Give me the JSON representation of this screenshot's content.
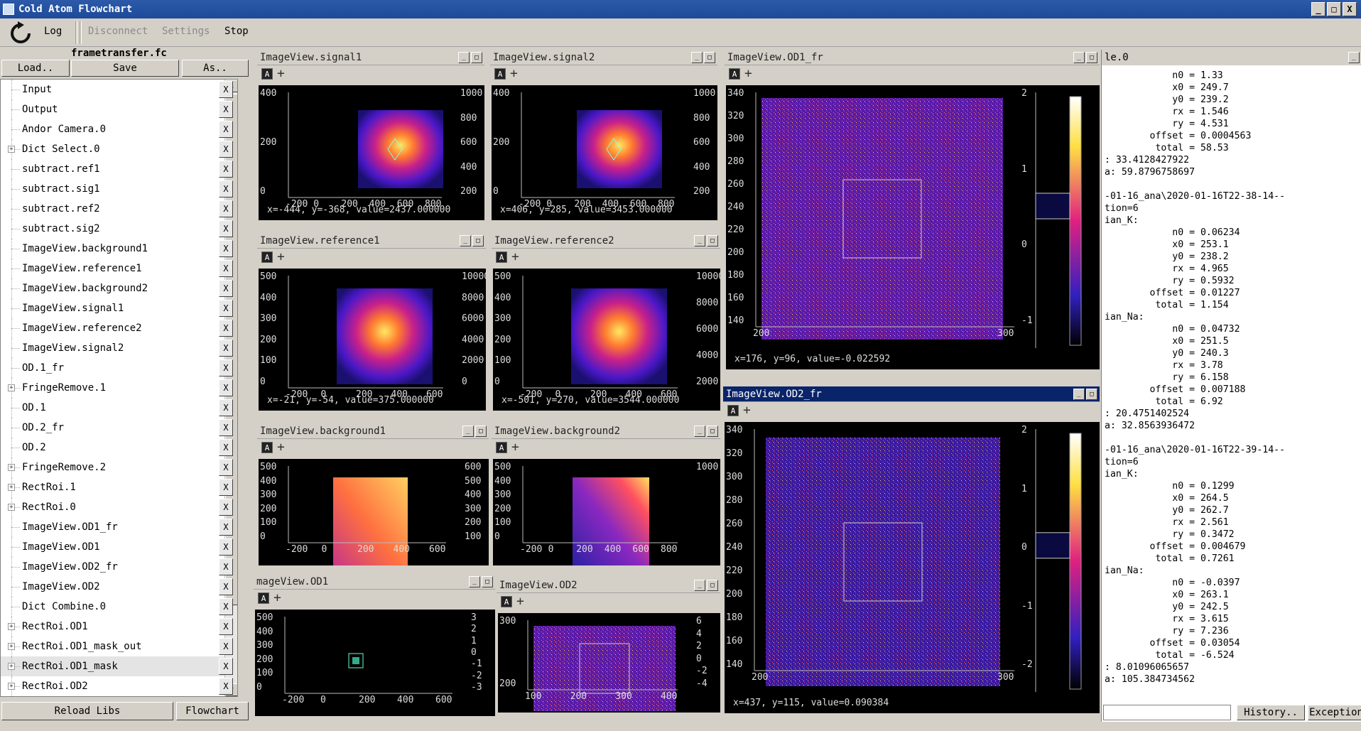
{
  "window": {
    "title": "Cold Atom Flowchart",
    "buttons": [
      "_",
      "□",
      "X"
    ]
  },
  "toolbar": {
    "log": "Log",
    "disconnect": "Disconnect",
    "settings": "Settings",
    "stop": "Stop"
  },
  "flowchart": {
    "filename": "frametransfer.fc",
    "load": "Load..",
    "save": "Save",
    "save_as": "As..",
    "reload_libs": "Reload Libs",
    "flowchart_btn": "Flowchart",
    "x_label": "X",
    "nodes": [
      {
        "label": "Input",
        "exp": false
      },
      {
        "label": "Output",
        "exp": false
      },
      {
        "label": "Andor Camera.0",
        "exp": false
      },
      {
        "label": "Dict Select.0",
        "exp": true
      },
      {
        "label": "subtract.ref1",
        "exp": false
      },
      {
        "label": "subtract.sig1",
        "exp": false
      },
      {
        "label": "subtract.ref2",
        "exp": false
      },
      {
        "label": "subtract.sig2",
        "exp": false
      },
      {
        "label": "ImageView.background1",
        "exp": false
      },
      {
        "label": "ImageView.reference1",
        "exp": false
      },
      {
        "label": "ImageView.background2",
        "exp": false
      },
      {
        "label": "ImageView.signal1",
        "exp": false
      },
      {
        "label": "ImageView.reference2",
        "exp": false
      },
      {
        "label": "ImageView.signal2",
        "exp": false
      },
      {
        "label": "OD.1_fr",
        "exp": false
      },
      {
        "label": "FringeRemove.1",
        "exp": true
      },
      {
        "label": "OD.1",
        "exp": false
      },
      {
        "label": "OD.2_fr",
        "exp": false
      },
      {
        "label": "OD.2",
        "exp": false
      },
      {
        "label": "FringeRemove.2",
        "exp": true
      },
      {
        "label": "RectRoi.1",
        "exp": true
      },
      {
        "label": "RectRoi.0",
        "exp": true
      },
      {
        "label": "ImageView.OD1_fr",
        "exp": false
      },
      {
        "label": "ImageView.OD1",
        "exp": false
      },
      {
        "label": "ImageView.OD2_fr",
        "exp": false
      },
      {
        "label": "ImageView.OD2",
        "exp": false
      },
      {
        "label": "Dict Combine.0",
        "exp": false
      },
      {
        "label": "RectRoi.OD1",
        "exp": true
      },
      {
        "label": "RectRoi.OD1_mask_out",
        "exp": true
      },
      {
        "label": "RectRoi.OD1_mask",
        "exp": true
      },
      {
        "label": "RectRoi.OD2",
        "exp": true
      }
    ]
  },
  "docks": {
    "signal1": {
      "title": "ImageView.signal1",
      "status": "x=-444, y=-368, value=2437.000000",
      "yticks": [
        "400",
        "200",
        "0"
      ],
      "xticks": [
        "-200",
        "0",
        "200",
        "400",
        "600",
        "800"
      ],
      "cbar": [
        "1000",
        "800",
        "600",
        "400",
        "200"
      ]
    },
    "signal2": {
      "title": "ImageView.signal2",
      "status": "x=406, y=285, value=3453.000000",
      "yticks": [
        "400",
        "200",
        "0"
      ],
      "xticks": [
        "-200",
        "0",
        "200",
        "400",
        "600",
        "800"
      ],
      "cbar": [
        "1000",
        "800",
        "600",
        "400",
        "200"
      ]
    },
    "reference1": {
      "title": "ImageView.reference1",
      "status": "x=-21, y=-54, value=375.000000",
      "yticks": [
        "500",
        "400",
        "300",
        "200",
        "100",
        "0"
      ],
      "xticks": [
        "-200",
        "0",
        "200",
        "400",
        "600"
      ],
      "cbar": [
        "10000",
        "8000",
        "6000",
        "4000",
        "2000",
        "0"
      ]
    },
    "reference2": {
      "title": "ImageView.reference2",
      "status": "x=-501, y=270, value=3544.000000",
      "yticks": [
        "500",
        "400",
        "300",
        "200",
        "100",
        "0"
      ],
      "xticks": [
        "-200",
        "0",
        "200",
        "400",
        "600"
      ],
      "cbar": [
        "10000",
        "8000",
        "6000",
        "4000",
        "2000"
      ]
    },
    "background1": {
      "title": "ImageView.background1",
      "yticks": [
        "500",
        "400",
        "300",
        "200",
        "100",
        "0"
      ],
      "xticks": [
        "-200",
        "0",
        "200",
        "400",
        "600"
      ],
      "cbar": [
        "600",
        "500",
        "400",
        "300",
        "200",
        "100"
      ]
    },
    "background2": {
      "title": "ImageView.background2",
      "yticks": [
        "500",
        "400",
        "300",
        "200",
        "100",
        "0"
      ],
      "xticks": [
        "-200",
        "0",
        "200",
        "400",
        "600",
        "800"
      ],
      "cbar": [
        "1000"
      ]
    },
    "od1": {
      "title": "mageView.OD1",
      "yticks": [
        "500",
        "400",
        "300",
        "200",
        "100",
        "0"
      ],
      "xticks": [
        "-200",
        "0",
        "200",
        "400",
        "600"
      ],
      "cbar": [
        "3",
        "2",
        "1",
        "0",
        "-1",
        "-2",
        "-3"
      ]
    },
    "od2": {
      "title": "ImageView.OD2",
      "yticks": [
        "300",
        "200"
      ],
      "xticks": [
        "100",
        "200",
        "300",
        "400"
      ],
      "cbar": [
        "6",
        "4",
        "2",
        "0",
        "-2",
        "-4"
      ]
    },
    "od1_fr": {
      "title": "ImageView.OD1_fr",
      "status": "x=176, y=96, value=-0.022592",
      "yticks": [
        "340",
        "320",
        "300",
        "280",
        "260",
        "240",
        "220",
        "200",
        "180",
        "160",
        "140"
      ],
      "xticks": [
        "200",
        "300"
      ],
      "cbar": [
        "2",
        "1",
        "0",
        "-1"
      ]
    },
    "od2_fr": {
      "title": "ImageView.OD2_fr",
      "status": "x=437, y=115, value=0.090384",
      "yticks": [
        "340",
        "320",
        "300",
        "280",
        "260",
        "240",
        "220",
        "200",
        "180",
        "160",
        "140"
      ],
      "xticks": [
        "200",
        "300"
      ],
      "cbar": [
        "2",
        "1",
        "0",
        "-1",
        "-2"
      ]
    }
  },
  "console": {
    "title": "le.0",
    "lines": [
      "            n0 = 1.33",
      "            x0 = 249.7",
      "            y0 = 239.2",
      "            rx = 1.546",
      "            ry = 4.531",
      "        offset = 0.0004563",
      "         total = 58.53",
      ": 33.4128427922",
      "a: 59.8796758697",
      "",
      "-01-16_ana\\2020-01-16T22-38-14--",
      "tion=6",
      "ian_K:",
      "            n0 = 0.06234",
      "            x0 = 253.1",
      "            y0 = 238.2",
      "            rx = 4.965",
      "            ry = 0.5932",
      "        offset = 0.01227",
      "         total = 1.154",
      "ian_Na:",
      "            n0 = 0.04732",
      "            x0 = 251.5",
      "            y0 = 240.3",
      "            rx = 3.78",
      "            ry = 6.158",
      "        offset = 0.007188",
      "         total = 6.92",
      ": 20.4751402524",
      "a: 32.8563936472",
      "",
      "-01-16_ana\\2020-01-16T22-39-14--",
      "tion=6",
      "ian_K:",
      "            n0 = 0.1299",
      "            x0 = 264.5",
      "            y0 = 262.7",
      "            rx = 2.561",
      "            ry = 0.3472",
      "        offset = 0.004679",
      "         total = 0.7261",
      "ian_Na:",
      "            n0 = -0.0397",
      "            x0 = 263.1",
      "            y0 = 242.5",
      "            rx = 3.615",
      "            ry = 7.236",
      "        offset = 0.03054",
      "         total = -6.524",
      ": 8.01096065657",
      "a: 105.384734562"
    ],
    "history": "History..",
    "exception": "Exception"
  }
}
